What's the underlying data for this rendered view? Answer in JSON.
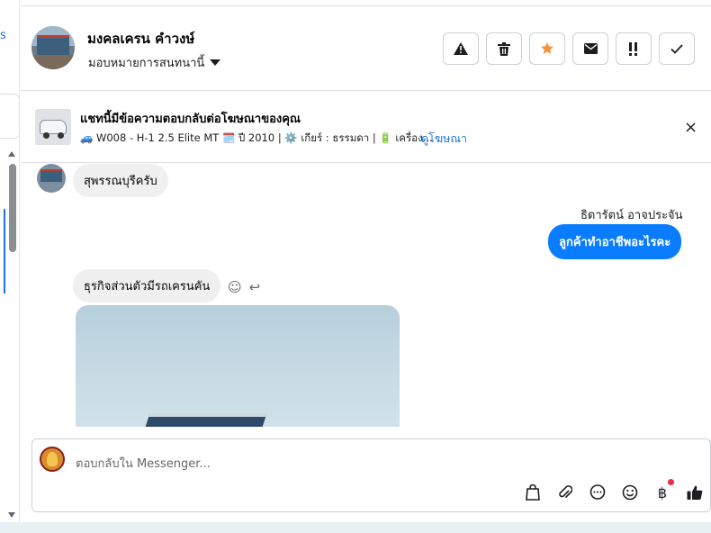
{
  "sidebar": {
    "cut_text": "s"
  },
  "header": {
    "name": "มงคลเครน คำวงษ์",
    "assign_label": "มอบหมายการสนทนานี้",
    "actions": [
      {
        "icon": "warning-icon"
      },
      {
        "icon": "trash-icon"
      },
      {
        "icon": "star-icon"
      },
      {
        "icon": "mail-icon"
      },
      {
        "icon": "priority-icon"
      },
      {
        "icon": "check-icon"
      }
    ],
    "colors": {
      "star": "#f7923b"
    }
  },
  "ad": {
    "title": "แชทนี้มีข้อความตอบกลับต่อโฆษณาของคุณ",
    "details": "🚙 W008 - H-1 2.5 Elite MT 🗓️ ปี 2010 | ⚙️ เกียร์ : ธรรมดา | 🔋 เครื่อง...",
    "link": "ดูโฆษณา",
    "close": "×"
  },
  "thread": {
    "msg1": "สุพรรณบุรีครับ",
    "sender": "ธิดารัตน์ อาจประจัน",
    "msg2": "ลูกค้าทำอาชีพอะไรคะ",
    "msg3": "ธุรกิจส่วนตัวมีรถเครนคัน",
    "react_icons": [
      "☺",
      "↩"
    ]
  },
  "composer": {
    "placeholder": "ตอบกลับใน Messenger...",
    "tools": [
      "bag-icon",
      "attach-icon",
      "chat-icon",
      "emoji-icon",
      "baht-icon",
      "thumbs-up-icon"
    ],
    "baht_symbol": "฿"
  }
}
